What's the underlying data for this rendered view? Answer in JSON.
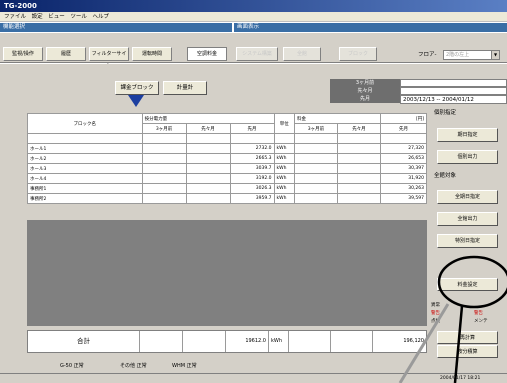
{
  "app": {
    "title": "TG-2000"
  },
  "menu": [
    "ファイル",
    "設定",
    "ビュー",
    "ツール",
    "ヘルプ"
  ],
  "sections": {
    "left": "機能選択",
    "right": "画面表示"
  },
  "tabs": [
    {
      "label": "監視/操作",
      "state": "normal"
    },
    {
      "label": "履歴",
      "state": "normal"
    },
    {
      "label": "フィルターサイン",
      "state": "normal"
    },
    {
      "label": "運転時間",
      "state": "normal"
    },
    {
      "label": "空調料金",
      "state": "active"
    },
    {
      "label": "システム構築",
      "state": "disabled"
    },
    {
      "label": "全館",
      "state": "disabled"
    },
    {
      "label": "ブロック",
      "state": "disabled"
    }
  ],
  "floor": {
    "label": "フロア-",
    "value": "2階の左上"
  },
  "toolbar": {
    "billing_block": "課金ブロック",
    "meter": "計量計"
  },
  "period": {
    "labels": [
      "3ヶ月前",
      "先々月",
      "先月"
    ],
    "range": "2003/12/13 -- 2004/01/12"
  },
  "table": {
    "headers": {
      "block": "ブロック名",
      "usage": "按分電力量",
      "charge": "料金",
      "unit": "単位",
      "yen": "[円]",
      "cols": [
        "3ヶ月前",
        "先々月",
        "先月"
      ]
    },
    "rows": [
      {
        "name": "ホール1",
        "usage": "2732.0",
        "unit": "kWh",
        "charge": "27,320"
      },
      {
        "name": "ホール2",
        "usage": "2665.3",
        "unit": "kWh",
        "charge": "26,653"
      },
      {
        "name": "ホール3",
        "usage": "3039.7",
        "unit": "kWh",
        "charge": "30,397"
      },
      {
        "name": "ホール4",
        "usage": "3192.0",
        "unit": "kWh",
        "charge": "31,920"
      },
      {
        "name": "事務所1",
        "usage": "3026.3",
        "unit": "kWh",
        "charge": "30,263"
      },
      {
        "name": "事務所2",
        "usage": "3959.7",
        "unit": "kWh",
        "charge": "39,597"
      }
    ],
    "total": {
      "label": "合計",
      "usage": "19612.0",
      "unit": "kWh",
      "charge": "196,120"
    }
  },
  "status": [
    "G-50 正常",
    "その他 正常",
    "WHM 正常"
  ],
  "right_panel": {
    "individual": "個別指定",
    "period_btn": "期日指定",
    "print_btn": "個別出力",
    "all": "全館対象",
    "all_period_btn": "全期日指定",
    "all_print_btn": "全館出力",
    "special_btn": "特別日指定",
    "charge_setting_btn": "料金設定",
    "legend": [
      "異常",
      "警告",
      "点検",
      "メンテ"
    ],
    "recalc_btn": "再計算",
    "allocate_btn": "按分積算"
  },
  "datetime": "2004/01/17  18:21"
}
